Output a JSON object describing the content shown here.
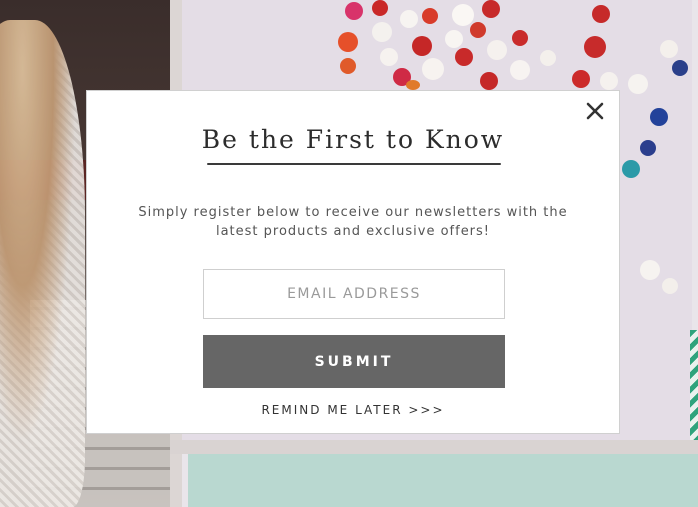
{
  "modal": {
    "title": "Be the First to Know",
    "description": "Simply register below to receive our newsletters with the latest products and exclusive offers!",
    "email_placeholder": "EMAIL ADDRESS",
    "submit_label": "SUBMIT",
    "remind_label": "REMIND ME LATER >>>",
    "close_icon": "close-icon"
  },
  "colors": {
    "submit_bg": "#666666",
    "modal_bg": "#ffffff",
    "title_text": "#2c2c2c"
  }
}
